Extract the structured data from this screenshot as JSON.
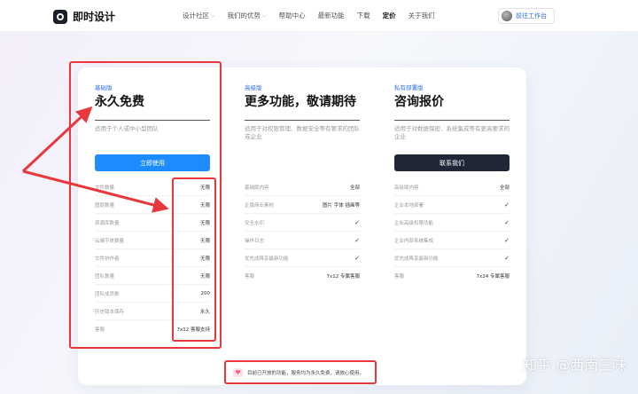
{
  "header": {
    "logo_text": "即时设计",
    "nav": [
      {
        "label": "设计社区",
        "dropdown": true
      },
      {
        "label": "我们的优势",
        "dropdown": true
      },
      {
        "label": "帮助中心",
        "dropdown": false
      },
      {
        "label": "最新功能",
        "dropdown": false
      },
      {
        "label": "下载",
        "dropdown": false
      },
      {
        "label": "定价",
        "dropdown": false,
        "active": true
      },
      {
        "label": "关于我们",
        "dropdown": false
      }
    ],
    "workspace_button": "前往工作台"
  },
  "plans": [
    {
      "tag": "基础版",
      "title": "永久免费",
      "desc": "适用于个人或中小型团队",
      "cta": "立即使用",
      "features": [
        {
          "label": "文件数量",
          "value": "无限"
        },
        {
          "label": "图层数量",
          "value": "无限"
        },
        {
          "label": "资源库数量",
          "value": "无限"
        },
        {
          "label": "云端字体数量",
          "value": "无限"
        },
        {
          "label": "文件协作者",
          "value": "无限"
        },
        {
          "label": "团队数量",
          "value": "无限"
        },
        {
          "label": "团队成员数",
          "value": "200"
        },
        {
          "label": "历史版本保存",
          "value": "永久"
        },
        {
          "label": "客服",
          "value": "7x12 客服支持"
        }
      ]
    },
    {
      "tag": "高级版",
      "title": "更多功能，敬请期待",
      "desc": "适用于对权限管理、数据安全等有要求的团队或企业",
      "cta": "",
      "features": [
        {
          "label": "基础版内容",
          "value": "全部"
        },
        {
          "label": "正版商业素材",
          "value": "图片 字体 插画等"
        },
        {
          "label": "安全水印",
          "value": "✓"
        },
        {
          "label": "操作日志",
          "value": "✓"
        },
        {
          "label": "优先成降享最新功能",
          "value": "✓"
        },
        {
          "label": "客服",
          "value": "7x12 专属客服"
        }
      ]
    },
    {
      "tag": "私有部署版",
      "title": "咨询报价",
      "desc": "适用于对数据保密、系统集成等有更高要求的企业",
      "cta": "联系我们",
      "features": [
        {
          "label": "高级版内容",
          "value": "全部"
        },
        {
          "label": "企业本地部署",
          "value": "✓"
        },
        {
          "label": "企业高级权限功能",
          "value": "✓"
        },
        {
          "label": "企业内部系统集成",
          "value": "✓"
        },
        {
          "label": "优先成降享最新功能",
          "value": "✓"
        },
        {
          "label": "客服",
          "value": "7x24 专属客服"
        }
      ]
    }
  ],
  "notice": {
    "icon": "heart-icon",
    "text": "目前已开放的功能，服务均为永久免费，请放心使用。"
  },
  "watermark": "知乎 @西南三味",
  "colors": {
    "accent_blue": "#1e8cff",
    "dark_button": "#1f2635",
    "annotation_red": "#e8383d",
    "tag_blue": "#2f6fe0"
  }
}
